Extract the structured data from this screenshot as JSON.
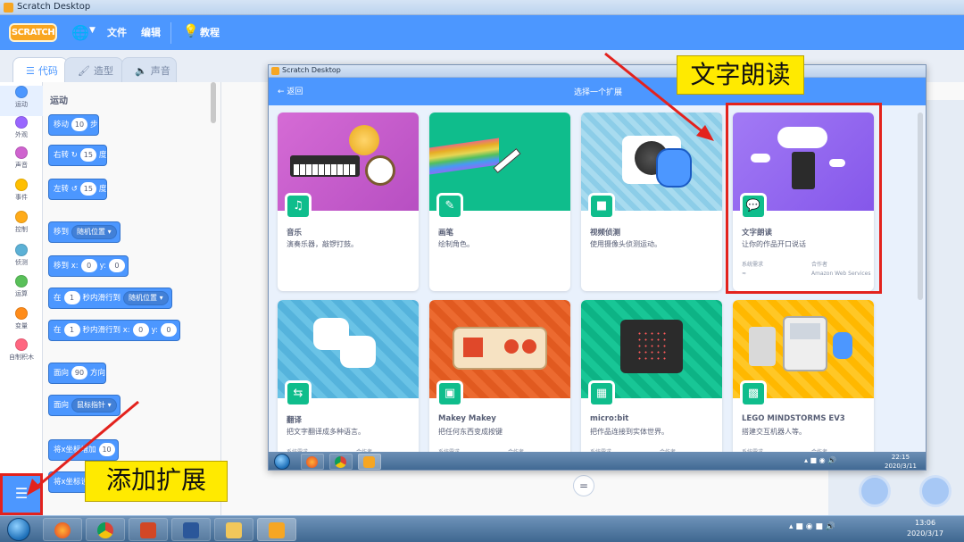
{
  "window": {
    "title": "Scratch Desktop"
  },
  "menubar": {
    "logo": "SCRATCH",
    "file": "文件",
    "edit": "编辑",
    "tutorials": "教程"
  },
  "tabs": [
    {
      "label": "代码",
      "icon": "code-icon"
    },
    {
      "label": "造型",
      "icon": "brush-icon"
    },
    {
      "label": "声音",
      "icon": "speaker-icon"
    }
  ],
  "categories": [
    {
      "label": "运动",
      "color": "#4c97ff"
    },
    {
      "label": "外观",
      "color": "#9966ff"
    },
    {
      "label": "声音",
      "color": "#cf63cf"
    },
    {
      "label": "事件",
      "color": "#ffbf00"
    },
    {
      "label": "控制",
      "color": "#ffab19"
    },
    {
      "label": "侦测",
      "color": "#5cb1d6"
    },
    {
      "label": "运算",
      "color": "#59c059"
    },
    {
      "label": "变量",
      "color": "#ff8c1a"
    },
    {
      "label": "自制积木",
      "color": "#ff6680"
    }
  ],
  "palette": {
    "section": "运动",
    "move": {
      "a": "移动",
      "v": "10",
      "b": "步"
    },
    "turn_right": {
      "a": "右转",
      "v": "15",
      "b": "度"
    },
    "turn_left": {
      "a": "左转",
      "v": "15",
      "b": "度"
    },
    "goto": {
      "a": "移到",
      "dd": "随机位置"
    },
    "goto_xy": {
      "a": "移到 x:",
      "x": "0",
      "b": "y:",
      "y": "0"
    },
    "glide": {
      "a": "在",
      "v": "1",
      "b": "秒内滑行到",
      "dd": "随机位置"
    },
    "glide_xy": {
      "a": "在",
      "v": "1",
      "b": "秒内滑行到 x:",
      "x": "0",
      "c": "y:",
      "y": "0"
    },
    "point_dir": {
      "a": "面向",
      "v": "90",
      "b": "方向"
    },
    "point_to": {
      "a": "面向",
      "dd": "鼠标指针"
    },
    "change_x": {
      "a": "将x坐标增加",
      "v": "10"
    },
    "set_x": {
      "a": "将x坐标设"
    }
  },
  "callouts": {
    "add_extension": "添加扩展",
    "text_to_speech": "文字朗读"
  },
  "inner_window": {
    "title": "Scratch Desktop",
    "back": "返回",
    "page_title": "选择一个扩展",
    "requires_label": "系统需求",
    "collab_label": "合作者",
    "clock_time": "22:15",
    "clock_date": "2020/3/11"
  },
  "extensions": [
    {
      "name": "音乐",
      "desc": "演奏乐器，敲锣打鼓。",
      "color": "#cf63cf",
      "icon": "music-icon"
    },
    {
      "name": "画笔",
      "desc": "绘制角色。",
      "color": "#0fbd8c",
      "icon": "pen-icon"
    },
    {
      "name": "视频侦测",
      "desc": "使用摄像头侦测运动。",
      "color": "#9fd4ec",
      "icon": "video-icon"
    },
    {
      "name": "文字朗读",
      "desc": "让你的作品开口说话",
      "color": "#9966ff",
      "icon": "speech-icon",
      "requires": "系统需求",
      "collab": "合作者",
      "collab_value": "Amazon Web Services"
    },
    {
      "name": "翻译",
      "desc": "把文字翻译成多种语言。",
      "color": "#5cb1d6",
      "icon": "translate-icon",
      "requires": "系统需求",
      "collab": "合作者"
    },
    {
      "name": "Makey Makey",
      "desc": "把任何东西变成按键",
      "color": "#e6521d",
      "icon": "makey-icon",
      "requires": "系统需求",
      "collab": "合作者"
    },
    {
      "name": "micro:bit",
      "desc": "把作品连接到实体世界。",
      "color": "#0fbd8c",
      "icon": "microbit-icon",
      "requires": "系统需求",
      "collab": "合作者"
    },
    {
      "name": "LEGO MINDSTORMS EV3",
      "desc": "搭建交互机器人等。",
      "color": "#ffbf00",
      "icon": "ev3-icon",
      "requires": "系统需求",
      "collab": "合作者"
    }
  ],
  "taskbar": {
    "time": "13:06",
    "date": "2020/3/17"
  }
}
